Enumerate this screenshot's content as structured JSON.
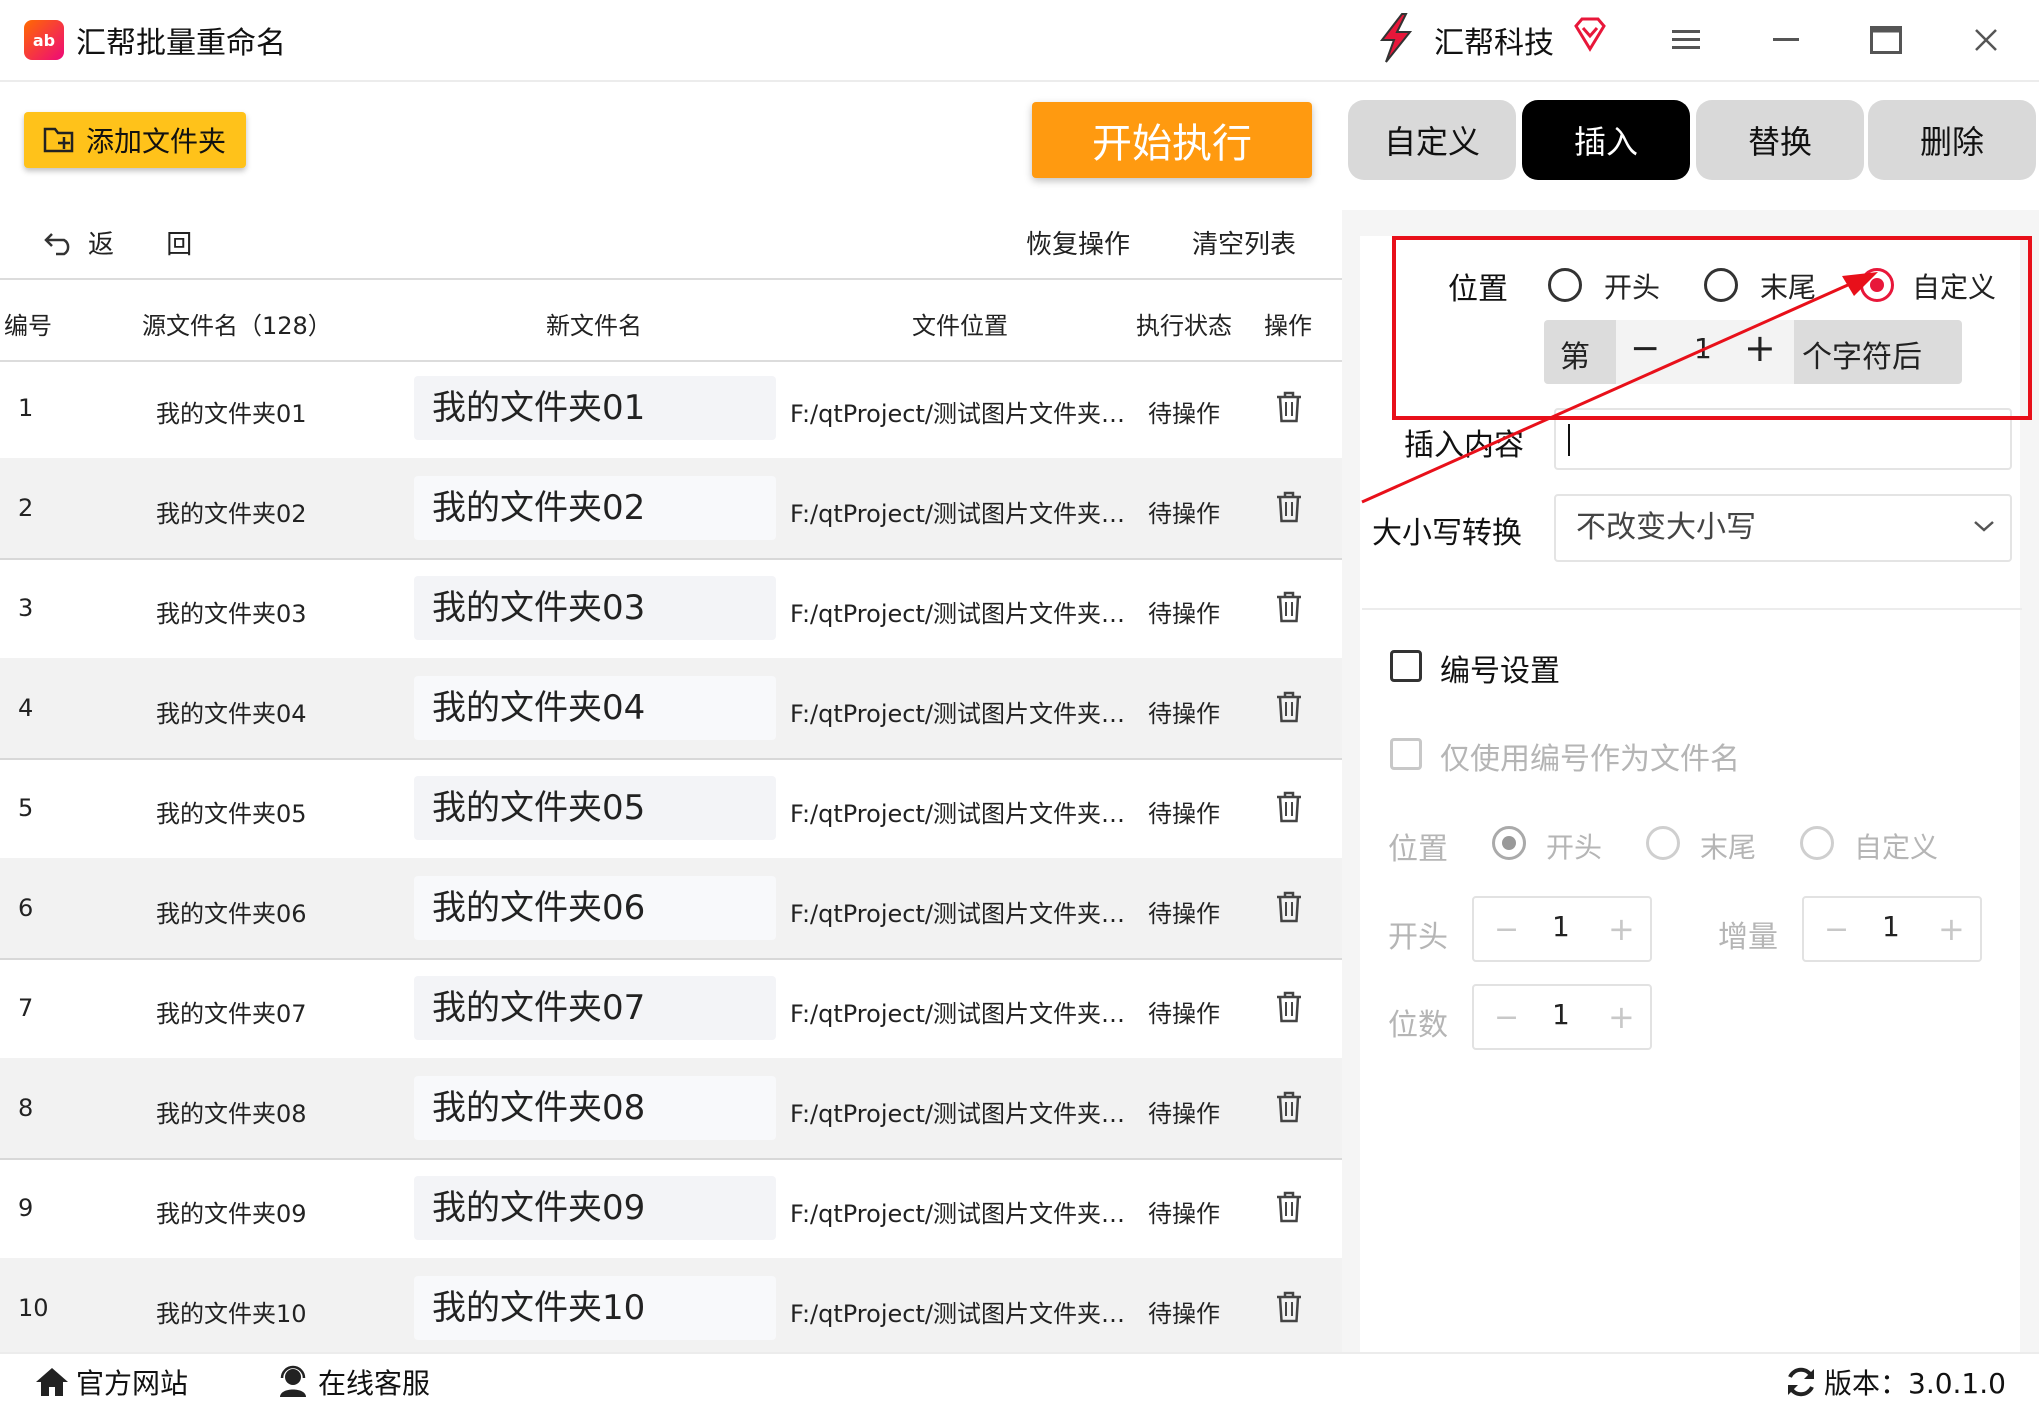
{
  "app": {
    "title": "汇帮批量重命名",
    "logo_text": "ab"
  },
  "brand": {
    "name": "汇帮科技"
  },
  "toolbar": {
    "add_folder": "添加文件夹",
    "start": "开始执行"
  },
  "tabs": [
    {
      "label": "自定义",
      "active": false
    },
    {
      "label": "插入",
      "active": true
    },
    {
      "label": "替换",
      "active": false
    },
    {
      "label": "删除",
      "active": false
    }
  ],
  "list_actions": {
    "back": "返 回",
    "restore": "恢复操作",
    "clear": "清空列表"
  },
  "table": {
    "headers": [
      "编号",
      "源文件名（128）",
      "新文件名",
      "文件位置",
      "执行状态",
      "操作"
    ],
    "rows": [
      {
        "idx": "1",
        "src": "我的文件夹01",
        "new": "我的文件夹01",
        "path": "F:/qtProject/测试图片文件夹/...",
        "status": "待操作"
      },
      {
        "idx": "2",
        "src": "我的文件夹02",
        "new": "我的文件夹02",
        "path": "F:/qtProject/测试图片文件夹/...",
        "status": "待操作"
      },
      {
        "idx": "3",
        "src": "我的文件夹03",
        "new": "我的文件夹03",
        "path": "F:/qtProject/测试图片文件夹/...",
        "status": "待操作"
      },
      {
        "idx": "4",
        "src": "我的文件夹04",
        "new": "我的文件夹04",
        "path": "F:/qtProject/测试图片文件夹/...",
        "status": "待操作"
      },
      {
        "idx": "5",
        "src": "我的文件夹05",
        "new": "我的文件夹05",
        "path": "F:/qtProject/测试图片文件夹/...",
        "status": "待操作"
      },
      {
        "idx": "6",
        "src": "我的文件夹06",
        "new": "我的文件夹06",
        "path": "F:/qtProject/测试图片文件夹/...",
        "status": "待操作"
      },
      {
        "idx": "7",
        "src": "我的文件夹07",
        "new": "我的文件夹07",
        "path": "F:/qtProject/测试图片文件夹/...",
        "status": "待操作"
      },
      {
        "idx": "8",
        "src": "我的文件夹08",
        "new": "我的文件夹08",
        "path": "F:/qtProject/测试图片文件夹/...",
        "status": "待操作"
      },
      {
        "idx": "9",
        "src": "我的文件夹09",
        "new": "我的文件夹09",
        "path": "F:/qtProject/测试图片文件夹/...",
        "status": "待操作"
      },
      {
        "idx": "10",
        "src": "我的文件夹10",
        "new": "我的文件夹10",
        "path": "F:/qtProject/测试图片文件夹/...",
        "status": "待操作"
      }
    ]
  },
  "insert_panel": {
    "position_label": "位置",
    "position_options": [
      "开头",
      "末尾",
      "自定义"
    ],
    "position_selected": "自定义",
    "stepper_prefix": "第",
    "stepper_minus": "−",
    "stepper_value": "1",
    "stepper_plus": "+",
    "stepper_suffix": "个字符后",
    "content_label": "插入内容",
    "content_value": "",
    "case_label": "大小写转换",
    "case_value": "不改变大小写"
  },
  "numbering": {
    "enable_label": "编号设置",
    "only_number_label": "仅使用编号作为文件名",
    "position_label": "位置",
    "position_options": [
      "开头",
      "末尾",
      "自定义"
    ],
    "start_label": "开头",
    "start_value": "1",
    "increment_label": "增量",
    "increment_value": "1",
    "digits_label": "位数",
    "digits_value": "1",
    "minus": "−",
    "plus": "+"
  },
  "footer": {
    "site": "官方网站",
    "support": "在线客服",
    "version": "版本：3.0.1.0"
  },
  "colors": {
    "accent": "#e8173a",
    "start_button": "#ff9a10",
    "add_button": "#ffc21a",
    "annotation": "#e8101a"
  }
}
